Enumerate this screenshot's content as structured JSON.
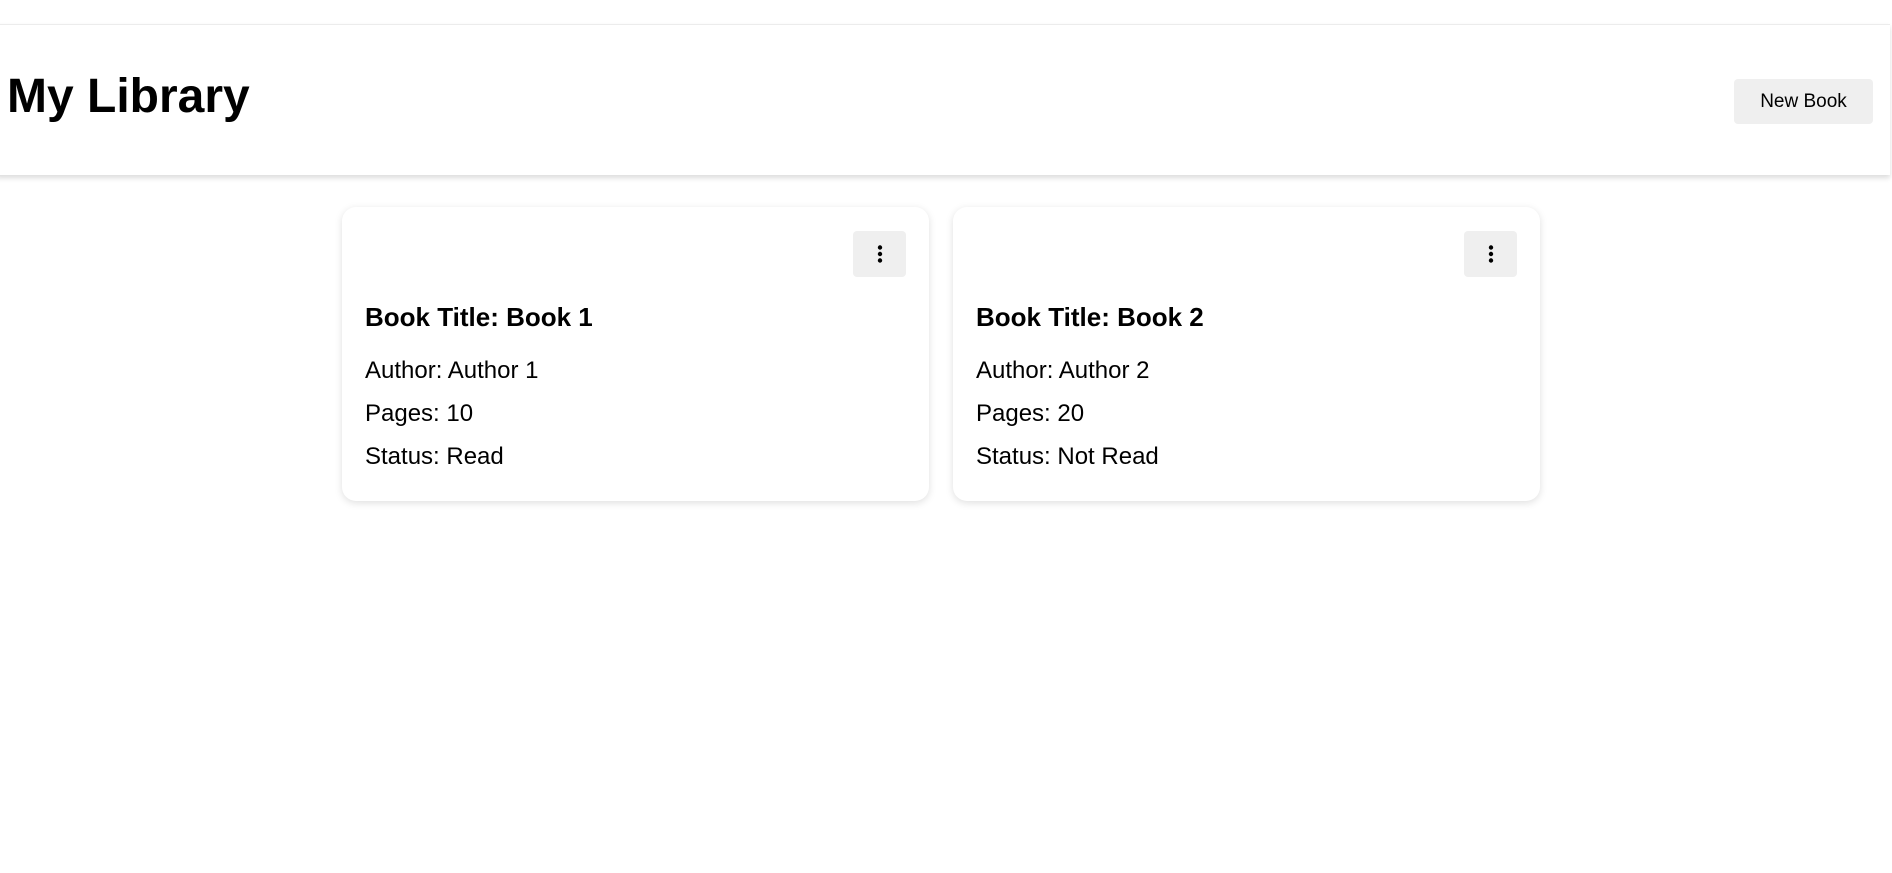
{
  "header": {
    "title": "My Library",
    "new_book_label": "New Book"
  },
  "books": [
    {
      "title": "Book Title: Book 1",
      "author": "Author: Author 1",
      "pages": "Pages: 10",
      "status": "Status: Read",
      "menu_icon": "more-vertical-icon"
    },
    {
      "title": "Book Title: Book 2",
      "author": "Author: Author 2",
      "pages": "Pages: 20",
      "status": "Status: Not Read",
      "menu_icon": "more-vertical-icon"
    }
  ],
  "colors": {
    "button_bg": "#efefef",
    "card_bg": "#ffffff",
    "text": "#000000"
  }
}
